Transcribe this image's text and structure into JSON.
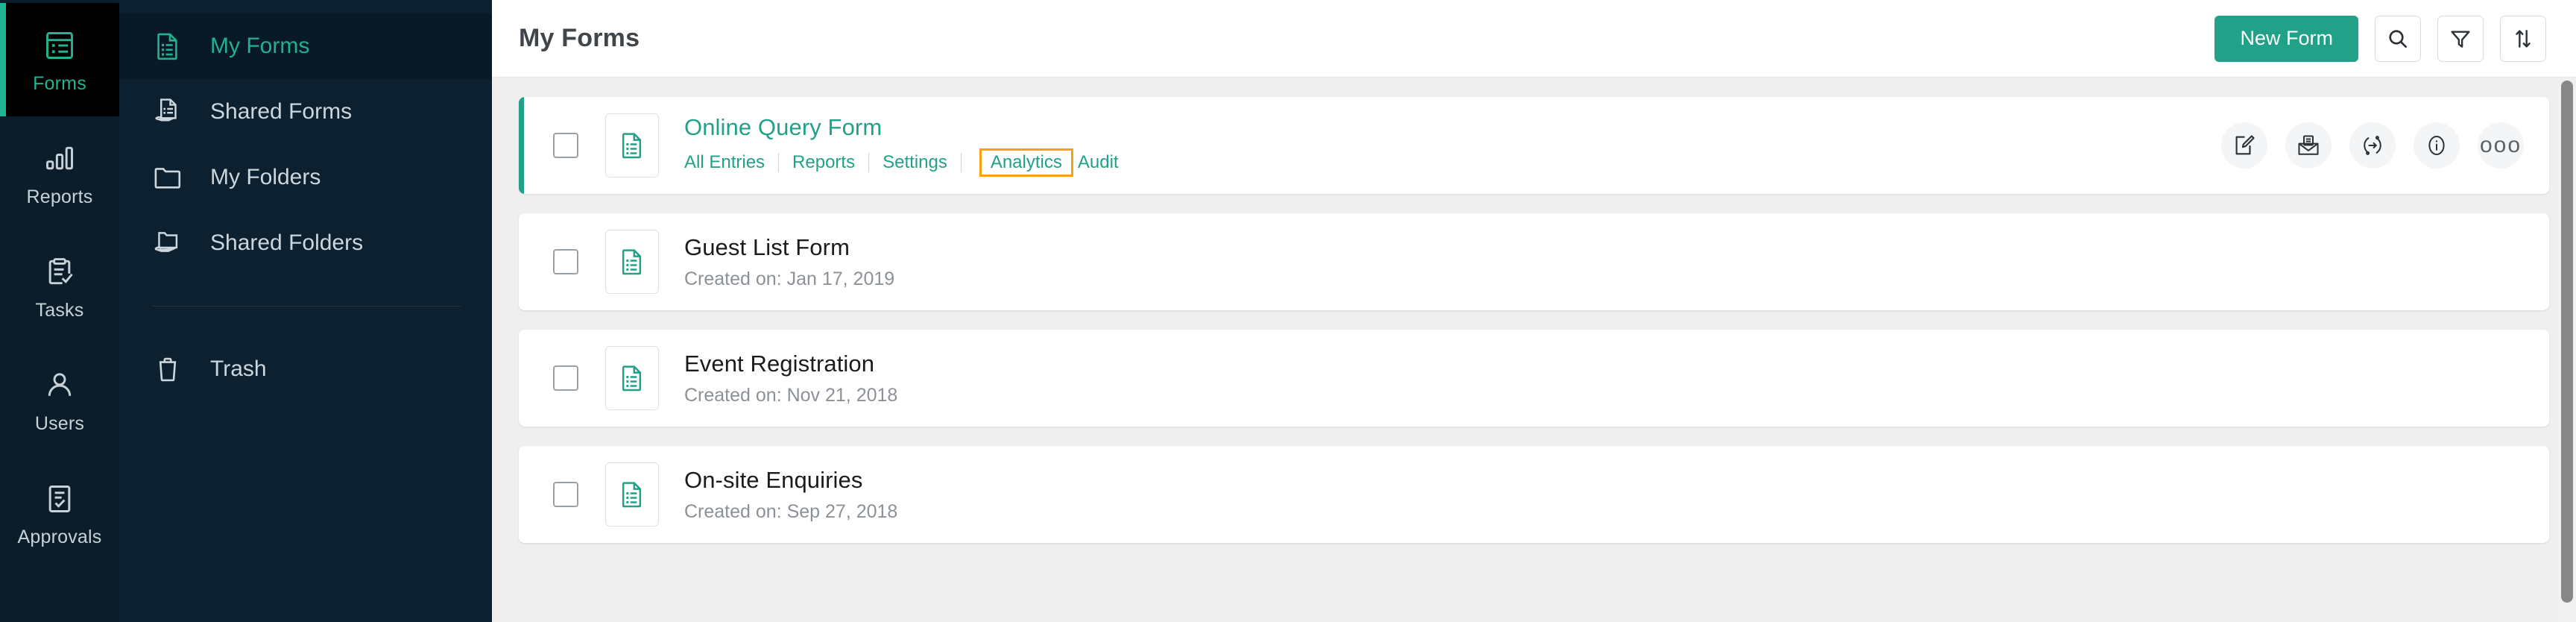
{
  "rail": {
    "items": [
      {
        "label": "Forms",
        "icon": "forms-icon",
        "active": true
      },
      {
        "label": "Reports",
        "icon": "bar-chart-icon",
        "active": false
      },
      {
        "label": "Tasks",
        "icon": "clipboard-check-icon",
        "active": false
      },
      {
        "label": "Users",
        "icon": "user-icon",
        "active": false
      },
      {
        "label": "Approvals",
        "icon": "approval-icon",
        "active": false
      }
    ]
  },
  "sidebar": {
    "items": [
      {
        "label": "My Forms",
        "icon": "document-list-icon",
        "active": true
      },
      {
        "label": "Shared Forms",
        "icon": "shared-document-icon",
        "active": false
      },
      {
        "label": "My Folders",
        "icon": "folder-icon",
        "active": false
      },
      {
        "label": "Shared Folders",
        "icon": "shared-folder-icon",
        "active": false
      }
    ],
    "trash": {
      "label": "Trash",
      "icon": "trash-icon"
    }
  },
  "header": {
    "title": "My Forms",
    "new_form_label": "New Form",
    "search_icon": "search-icon",
    "filter_icon": "filter-icon",
    "sort_icon": "sort-icon"
  },
  "forms": [
    {
      "name": "Online Query Form",
      "selected": true,
      "expanded": true,
      "links": [
        {
          "label": "All Entries",
          "highlighted": false
        },
        {
          "label": "Reports",
          "highlighted": false
        },
        {
          "label": "Settings",
          "highlighted": false
        },
        {
          "label": "Analytics",
          "highlighted": true
        },
        {
          "label": "Audit",
          "highlighted": false
        }
      ],
      "actions": [
        {
          "name": "edit-form-button",
          "icon": "edit-pencil-icon"
        },
        {
          "name": "share-form-button",
          "icon": "envelope-icon"
        },
        {
          "name": "integrations-button",
          "icon": "circular-arrow-icon"
        },
        {
          "name": "info-button",
          "icon": "info-icon"
        },
        {
          "name": "more-options-button",
          "icon": "more-dots-icon",
          "glyph": "ooo"
        }
      ]
    },
    {
      "name": "Guest List Form",
      "created": "Created on: Jan 17, 2019",
      "selected": false,
      "expanded": false
    },
    {
      "name": "Event Registration",
      "created": "Created on: Nov 21, 2018",
      "selected": false,
      "expanded": false
    },
    {
      "name": "On-site Enquiries",
      "created": "Created on: Sep 27, 2018",
      "selected": false,
      "expanded": false
    }
  ],
  "colors": {
    "accent_teal": "#21a188",
    "rail_bg": "#0b1d2a",
    "sidebar_bg": "#0c2030",
    "active_rail_bg": "#000000",
    "highlight_orange": "#f5a314",
    "list_bg": "#efefef"
  }
}
